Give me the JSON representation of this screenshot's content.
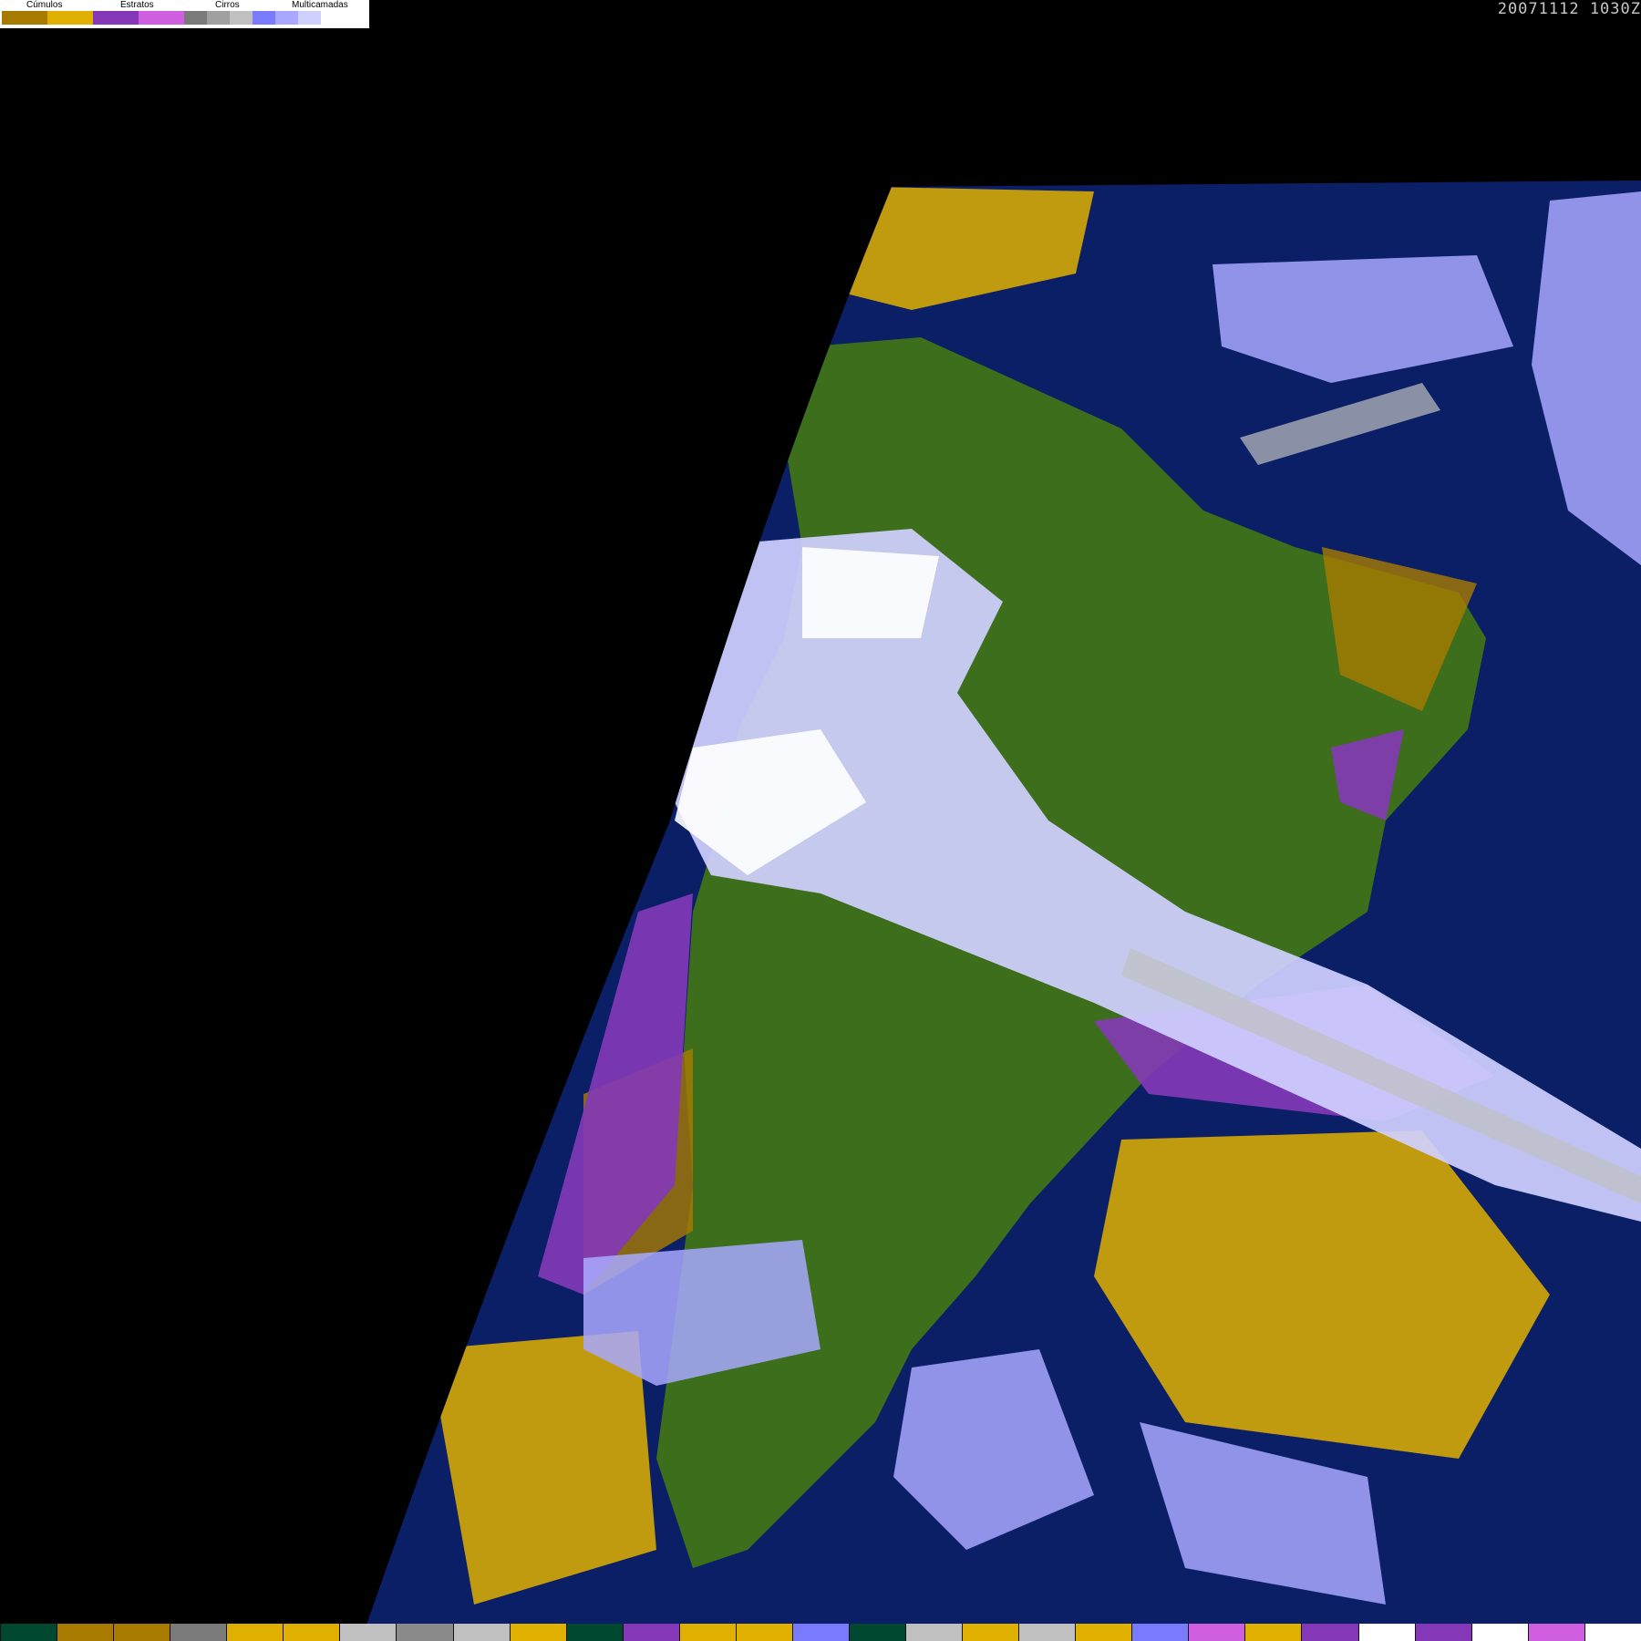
{
  "legend": {
    "groups": [
      {
        "label": "Cúmulos",
        "colors": [
          "#a87a00",
          "#e0b000"
        ]
      },
      {
        "label": "Estratos",
        "colors": [
          "#8438b8",
          "#d05ee0"
        ]
      },
      {
        "label": "Cirros",
        "colors": [
          "#7a7a7a",
          "#a0a0a0",
          "#c0c0c0"
        ]
      },
      {
        "label": "Multicamadas",
        "colors": [
          "#7a7aff",
          "#a8a8ff",
          "#d0d0ff",
          "#ffffff"
        ]
      }
    ]
  },
  "timestamp": "20071112 1030Z",
  "colors": {
    "ocean": "#0a1f66",
    "land": "#3c6e1c",
    "space": "#000000"
  },
  "colorbar": [
    "#004830",
    "#a87a00",
    "#a87a00",
    "#7a7a7a",
    "#e0b000",
    "#e0b000",
    "#c0c0c0",
    "#8a8a8a",
    "#c0c0c0",
    "#e0b000",
    "#004830",
    "#8438b8",
    "#e0b000",
    "#e0b000",
    "#7a7aff",
    "#004830",
    "#c0c0c0",
    "#e0b000",
    "#c0c0c0",
    "#e0b000",
    "#7a7aff",
    "#d05ee0",
    "#e0b000",
    "#8438b8",
    "#ffffff",
    "#8438b8",
    "#ffffff",
    "#d05ee0",
    "#ffffff"
  ]
}
